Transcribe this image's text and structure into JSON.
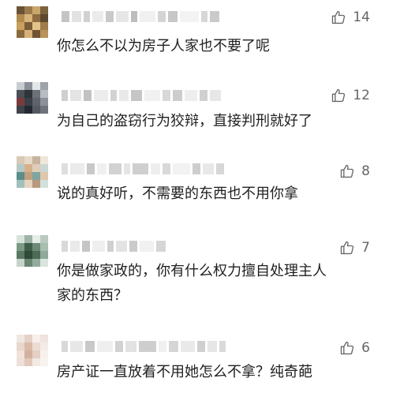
{
  "comments": [
    {
      "likes": "14",
      "text": "你怎么不以为房子人家也不要了呢"
    },
    {
      "likes": "12",
      "text": "为自己的盗窃行为狡辩，直接判刑就好了"
    },
    {
      "likes": "8",
      "text": "说的真好听，不需要的东西也不用你拿"
    },
    {
      "likes": "7",
      "text": "你是做家政的，你有什么权力擅自处理主人\n家的东西？"
    },
    {
      "likes": "6",
      "text": "房产证一直放着不用她怎么不拿？纯奇葩"
    }
  ],
  "colors": {
    "like_icon": "#666666",
    "text": "#1f1f1f"
  },
  "icons": [
    "avatar-icon",
    "thumbs-up-icon"
  ]
}
